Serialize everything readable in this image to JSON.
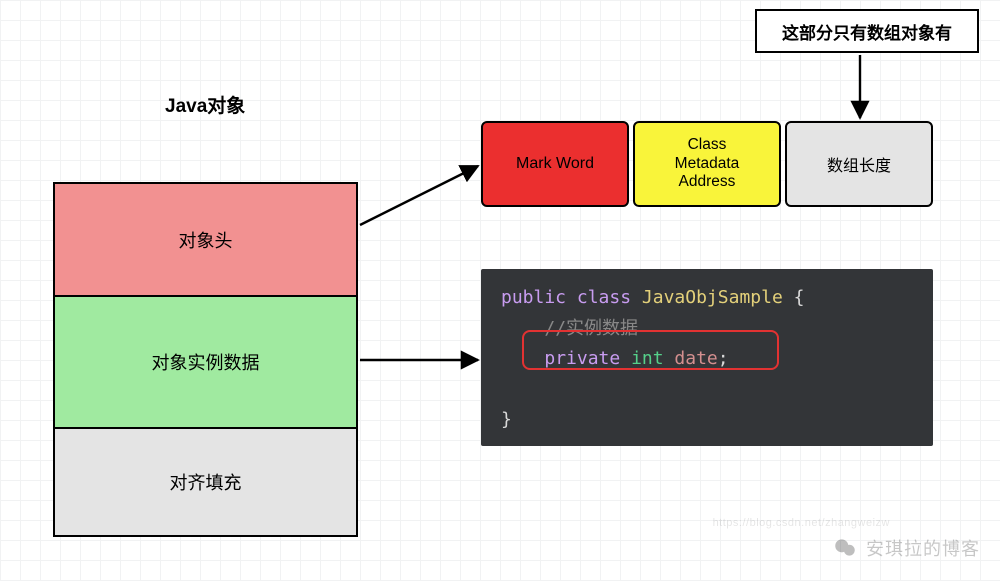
{
  "title": "Java对象",
  "left_column": {
    "header": "对象头",
    "instance": "对象实例数据",
    "padding": "对齐填充"
  },
  "header_parts": {
    "mark_word": "Mark Word",
    "class_metadata_address": "Class\nMetadata\nAddress",
    "array_length": "数组长度"
  },
  "callout": "这部分只有数组对象有",
  "code": {
    "line1_public": "public",
    "line1_class": "class",
    "line1_name": "JavaObjSample",
    "line1_open": " {",
    "line2_comment": "//实例数据",
    "line3_private": "private",
    "line3_type": "int",
    "line3_var": "date",
    "line3_semi": ";",
    "line5_close": "}"
  },
  "watermark": {
    "text": "安琪拉的博客",
    "url_hint": "https://blog.csdn.net/zhangweizw"
  }
}
